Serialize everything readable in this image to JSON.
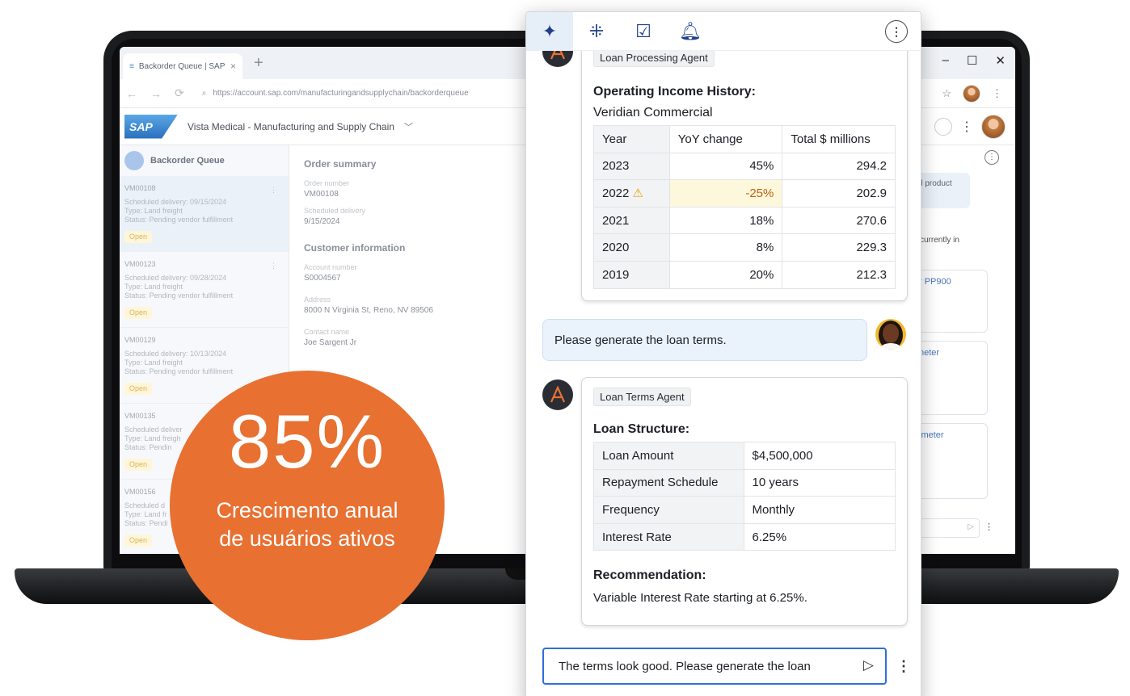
{
  "browser": {
    "tab_title": "Backorder Queue | SAP",
    "url": "https://account.sap.com/manufacturingandsupplychain/backorderqueue"
  },
  "sap": {
    "logo": "SAP",
    "app_title": "Vista Medical - Manufacturing and Supply Chain",
    "sidebar_title": "Backorder Queue",
    "orders": [
      {
        "id": "VM00108",
        "delivery": "Scheduled delivery: 09/15/2024",
        "type": "Type: Land freight",
        "status": "Status: Pending vendor fulfillment",
        "badge": "Open"
      },
      {
        "id": "VM00123",
        "delivery": "Scheduled delivery: 09/28/2024",
        "type": "Type: Land freight",
        "status": "Status: Pending vendor fulfillment",
        "badge": "Open"
      },
      {
        "id": "VM00129",
        "delivery": "Scheduled delivery: 10/13/2024",
        "type": "Type: Land freight",
        "status": "Status: Pending vendor fulfillment",
        "badge": "Open"
      },
      {
        "id": "VM00135",
        "delivery": "Scheduled deliver",
        "type": "Type: Land freigh",
        "status": "Status: Pendin",
        "badge": "Open"
      },
      {
        "id": "VM00156",
        "delivery": "Scheduled d",
        "type": "Type: Land fr",
        "status": "Status: Pendi",
        "badge": "Open"
      }
    ],
    "order_summary": {
      "heading": "Order summary",
      "order_number_label": "Order number",
      "order_number": "VM00108",
      "scheduled_label": "Scheduled delivery",
      "scheduled": "9/15/2024"
    },
    "customer": {
      "heading": "Customer information",
      "account_label": "Account number",
      "account": "S0004567",
      "address_label": "Address",
      "address": "8000 N Virginia St, Reno, NV 89506",
      "contact_label": "Contact name",
      "contact": "Joe Sargent Jr"
    },
    "right_pane": {
      "bubble": "d product",
      "line1": "currently in",
      "card1": "r PP900",
      "card2": "neter",
      "card3": "imeter"
    }
  },
  "chat": {
    "card1": {
      "agent": "Loan Processing Agent",
      "title": "Operating Income History:",
      "subtitle": "Veridian Commercial",
      "headers": [
        "Year",
        "YoY change",
        "Total $ millions"
      ],
      "rows": [
        {
          "year": "2023",
          "yoy": "45%",
          "total": "294.2"
        },
        {
          "year": "2022",
          "yoy": "-25%",
          "total": "202.9"
        },
        {
          "year": "2021",
          "yoy": "18%",
          "total": "270.6"
        },
        {
          "year": "2020",
          "yoy": "8%",
          "total": "229.3"
        },
        {
          "year": "2019",
          "yoy": "20%",
          "total": "212.3"
        }
      ]
    },
    "user_message": "Please generate the loan terms.",
    "card2": {
      "agent": "Loan Terms Agent",
      "title": "Loan Structure:",
      "rows": [
        {
          "key": "Loan Amount",
          "value": "$4,500,000"
        },
        {
          "key": "Repayment Schedule",
          "value": "10 years"
        },
        {
          "key": "Frequency",
          "value": "Monthly"
        },
        {
          "key": "Interest Rate",
          "value": "6.25%"
        }
      ],
      "rec_title": "Recommendation:",
      "rec_text": "Variable Interest Rate starting at 6.25%."
    },
    "composer_text": "The terms look good. Please generate the loan"
  },
  "stat": {
    "number": "85%",
    "label": "Crescimento anual de usuários ativos",
    "color": "#e87031"
  }
}
